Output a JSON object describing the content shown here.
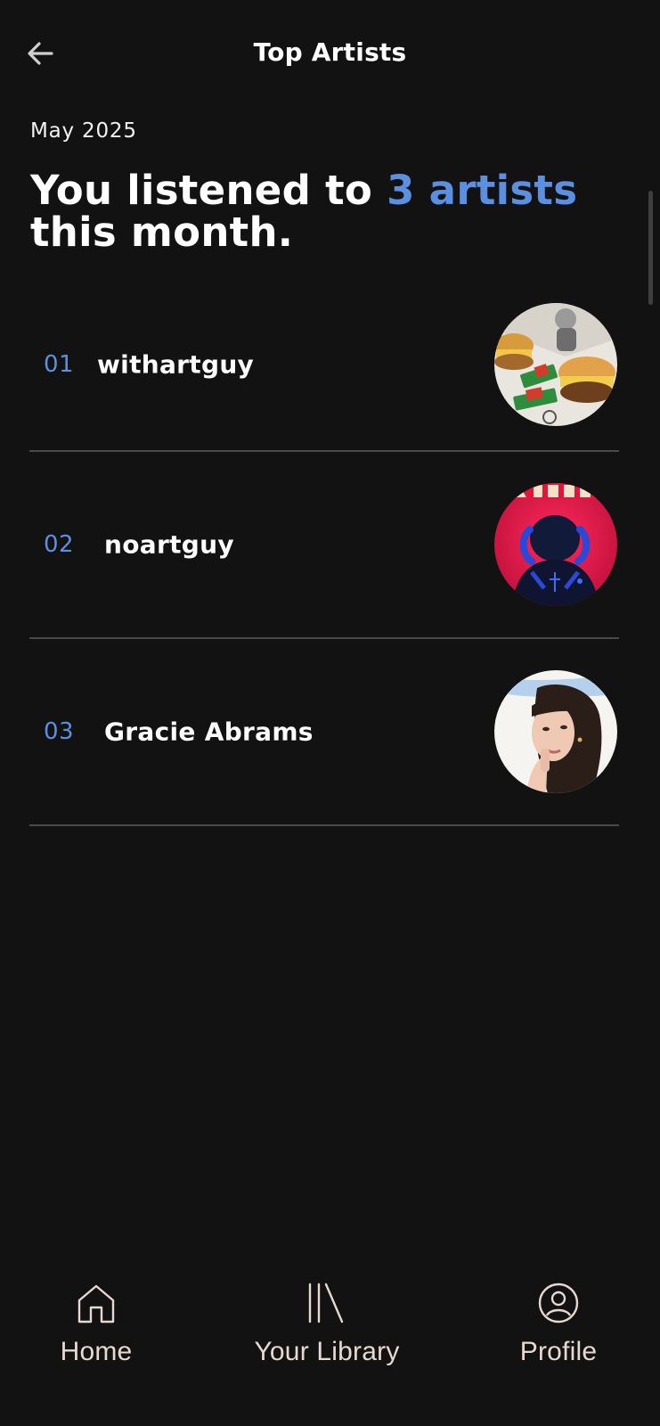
{
  "header": {
    "title": "Top Artists",
    "back_icon": "arrow-left-icon"
  },
  "summary": {
    "month": "May 2025",
    "headline_prefix": "You listened to ",
    "headline_accent": "3 artists",
    "headline_suffix": "this month."
  },
  "artists": [
    {
      "rank": "01",
      "name": "withartguy"
    },
    {
      "rank": "02",
      "name": "noartguy"
    },
    {
      "rank": "03",
      "name": "Gracie Abrams"
    }
  ],
  "bottom_nav": [
    {
      "label": "Home",
      "icon": "home-icon"
    },
    {
      "label": "Your Library",
      "icon": "library-icon"
    },
    {
      "label": "Profile",
      "icon": "profile-icon"
    }
  ],
  "colors": {
    "background": "#121212",
    "accent": "#5b8fe0",
    "text": "#ffffff",
    "divider": "#4a4a4a",
    "nav_text": "#e8d8cf"
  }
}
